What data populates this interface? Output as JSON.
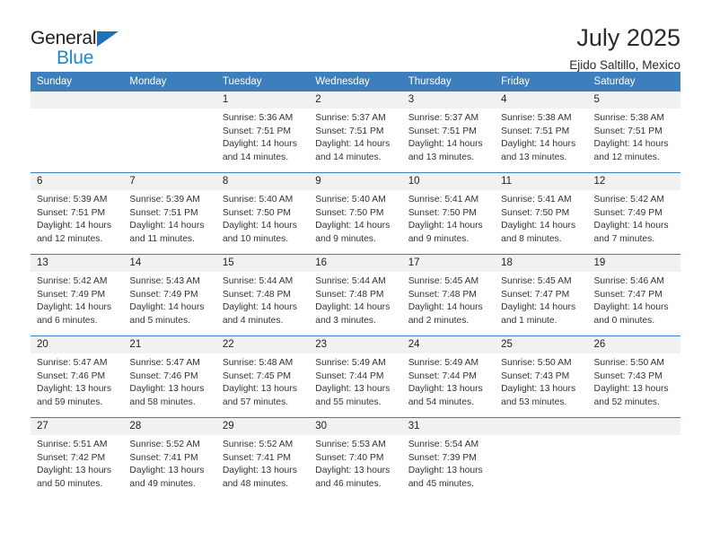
{
  "brand": {
    "name_top": "General",
    "name_bottom": "Blue",
    "accent_color": "#1f86d0",
    "triangle_color": "#1f72b8"
  },
  "header": {
    "title": "July 2025",
    "subtitle": "Ejido Saltillo, Mexico"
  },
  "theme": {
    "header_row_bg": "#3d7ebd",
    "daynum_bg": "#f1f1f1",
    "rule_color": "#3d7ebd"
  },
  "weekday_headers": [
    "Sunday",
    "Monday",
    "Tuesday",
    "Wednesday",
    "Thursday",
    "Friday",
    "Saturday"
  ],
  "labels": {
    "sunrise_prefix": "Sunrise:",
    "sunset_prefix": "Sunset:",
    "daylight_prefix": "Daylight:"
  },
  "weeks": [
    [
      {
        "day": "",
        "sunrise": "",
        "sunset": "",
        "daylight": ""
      },
      {
        "day": "",
        "sunrise": "",
        "sunset": "",
        "daylight": ""
      },
      {
        "day": "1",
        "sunrise": "Sunrise: 5:36 AM",
        "sunset": "Sunset: 7:51 PM",
        "daylight": "Daylight: 14 hours and 14 minutes."
      },
      {
        "day": "2",
        "sunrise": "Sunrise: 5:37 AM",
        "sunset": "Sunset: 7:51 PM",
        "daylight": "Daylight: 14 hours and 14 minutes."
      },
      {
        "day": "3",
        "sunrise": "Sunrise: 5:37 AM",
        "sunset": "Sunset: 7:51 PM",
        "daylight": "Daylight: 14 hours and 13 minutes."
      },
      {
        "day": "4",
        "sunrise": "Sunrise: 5:38 AM",
        "sunset": "Sunset: 7:51 PM",
        "daylight": "Daylight: 14 hours and 13 minutes."
      },
      {
        "day": "5",
        "sunrise": "Sunrise: 5:38 AM",
        "sunset": "Sunset: 7:51 PM",
        "daylight": "Daylight: 14 hours and 12 minutes."
      }
    ],
    [
      {
        "day": "6",
        "sunrise": "Sunrise: 5:39 AM",
        "sunset": "Sunset: 7:51 PM",
        "daylight": "Daylight: 14 hours and 12 minutes."
      },
      {
        "day": "7",
        "sunrise": "Sunrise: 5:39 AM",
        "sunset": "Sunset: 7:51 PM",
        "daylight": "Daylight: 14 hours and 11 minutes."
      },
      {
        "day": "8",
        "sunrise": "Sunrise: 5:40 AM",
        "sunset": "Sunset: 7:50 PM",
        "daylight": "Daylight: 14 hours and 10 minutes."
      },
      {
        "day": "9",
        "sunrise": "Sunrise: 5:40 AM",
        "sunset": "Sunset: 7:50 PM",
        "daylight": "Daylight: 14 hours and 9 minutes."
      },
      {
        "day": "10",
        "sunrise": "Sunrise: 5:41 AM",
        "sunset": "Sunset: 7:50 PM",
        "daylight": "Daylight: 14 hours and 9 minutes."
      },
      {
        "day": "11",
        "sunrise": "Sunrise: 5:41 AM",
        "sunset": "Sunset: 7:50 PM",
        "daylight": "Daylight: 14 hours and 8 minutes."
      },
      {
        "day": "12",
        "sunrise": "Sunrise: 5:42 AM",
        "sunset": "Sunset: 7:49 PM",
        "daylight": "Daylight: 14 hours and 7 minutes."
      }
    ],
    [
      {
        "day": "13",
        "sunrise": "Sunrise: 5:42 AM",
        "sunset": "Sunset: 7:49 PM",
        "daylight": "Daylight: 14 hours and 6 minutes."
      },
      {
        "day": "14",
        "sunrise": "Sunrise: 5:43 AM",
        "sunset": "Sunset: 7:49 PM",
        "daylight": "Daylight: 14 hours and 5 minutes."
      },
      {
        "day": "15",
        "sunrise": "Sunrise: 5:44 AM",
        "sunset": "Sunset: 7:48 PM",
        "daylight": "Daylight: 14 hours and 4 minutes."
      },
      {
        "day": "16",
        "sunrise": "Sunrise: 5:44 AM",
        "sunset": "Sunset: 7:48 PM",
        "daylight": "Daylight: 14 hours and 3 minutes."
      },
      {
        "day": "17",
        "sunrise": "Sunrise: 5:45 AM",
        "sunset": "Sunset: 7:48 PM",
        "daylight": "Daylight: 14 hours and 2 minutes."
      },
      {
        "day": "18",
        "sunrise": "Sunrise: 5:45 AM",
        "sunset": "Sunset: 7:47 PM",
        "daylight": "Daylight: 14 hours and 1 minute."
      },
      {
        "day": "19",
        "sunrise": "Sunrise: 5:46 AM",
        "sunset": "Sunset: 7:47 PM",
        "daylight": "Daylight: 14 hours and 0 minutes."
      }
    ],
    [
      {
        "day": "20",
        "sunrise": "Sunrise: 5:47 AM",
        "sunset": "Sunset: 7:46 PM",
        "daylight": "Daylight: 13 hours and 59 minutes."
      },
      {
        "day": "21",
        "sunrise": "Sunrise: 5:47 AM",
        "sunset": "Sunset: 7:46 PM",
        "daylight": "Daylight: 13 hours and 58 minutes."
      },
      {
        "day": "22",
        "sunrise": "Sunrise: 5:48 AM",
        "sunset": "Sunset: 7:45 PM",
        "daylight": "Daylight: 13 hours and 57 minutes."
      },
      {
        "day": "23",
        "sunrise": "Sunrise: 5:49 AM",
        "sunset": "Sunset: 7:44 PM",
        "daylight": "Daylight: 13 hours and 55 minutes."
      },
      {
        "day": "24",
        "sunrise": "Sunrise: 5:49 AM",
        "sunset": "Sunset: 7:44 PM",
        "daylight": "Daylight: 13 hours and 54 minutes."
      },
      {
        "day": "25",
        "sunrise": "Sunrise: 5:50 AM",
        "sunset": "Sunset: 7:43 PM",
        "daylight": "Daylight: 13 hours and 53 minutes."
      },
      {
        "day": "26",
        "sunrise": "Sunrise: 5:50 AM",
        "sunset": "Sunset: 7:43 PM",
        "daylight": "Daylight: 13 hours and 52 minutes."
      }
    ],
    [
      {
        "day": "27",
        "sunrise": "Sunrise: 5:51 AM",
        "sunset": "Sunset: 7:42 PM",
        "daylight": "Daylight: 13 hours and 50 minutes."
      },
      {
        "day": "28",
        "sunrise": "Sunrise: 5:52 AM",
        "sunset": "Sunset: 7:41 PM",
        "daylight": "Daylight: 13 hours and 49 minutes."
      },
      {
        "day": "29",
        "sunrise": "Sunrise: 5:52 AM",
        "sunset": "Sunset: 7:41 PM",
        "daylight": "Daylight: 13 hours and 48 minutes."
      },
      {
        "day": "30",
        "sunrise": "Sunrise: 5:53 AM",
        "sunset": "Sunset: 7:40 PM",
        "daylight": "Daylight: 13 hours and 46 minutes."
      },
      {
        "day": "31",
        "sunrise": "Sunrise: 5:54 AM",
        "sunset": "Sunset: 7:39 PM",
        "daylight": "Daylight: 13 hours and 45 minutes."
      },
      {
        "day": "",
        "sunrise": "",
        "sunset": "",
        "daylight": ""
      },
      {
        "day": "",
        "sunrise": "",
        "sunset": "",
        "daylight": ""
      }
    ]
  ]
}
